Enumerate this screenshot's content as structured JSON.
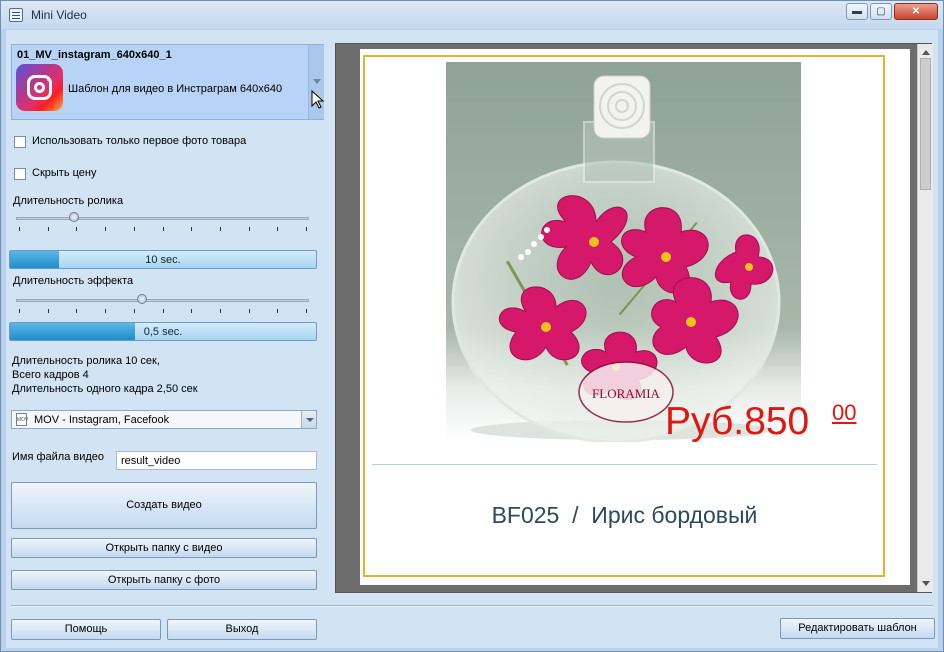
{
  "window": {
    "title": "Mini Video",
    "min_glyph": "▬",
    "max_glyph": "▢",
    "close_glyph": "✕"
  },
  "template": {
    "name": "01_MV_instagram_640x640_1",
    "description": "Шаблон для видео в Инстраграм 640x640",
    "icon": "instagram-icon"
  },
  "options": {
    "first_photo_only_label": "Использовать только первое фото товара",
    "first_photo_only_checked": false,
    "hide_price_label": "Скрыть цену",
    "hide_price_checked": false
  },
  "duration": {
    "label": "Длительность ролика",
    "slider_position": 0.19,
    "progress_text": "10 sec.",
    "progress_fraction": 0.16
  },
  "effect": {
    "label": "Длительность эффекта",
    "slider_position": 0.43,
    "progress_text": "0,5 sec.",
    "progress_fraction": 0.41
  },
  "summary": {
    "line1": "Длительность ролика 10 сек,",
    "line2": "Всего кадров 4",
    "line3": "Длительность одного кадра 2,50 сек"
  },
  "format": {
    "selected": "MOV - Instagram, Facefook",
    "icon_text": "MOV"
  },
  "filename": {
    "label": "Имя файла видео",
    "value": "result_video"
  },
  "buttons": {
    "create": "Создать видео",
    "open_video_folder": "Открыть папку с видео",
    "open_photo_folder": "Открыть папку с фото",
    "help": "Помощь",
    "exit": "Выход",
    "edit_template": "Редактировать шаблон"
  },
  "preview": {
    "price_main": "Руб.850",
    "price_cents": "00",
    "product_title": "BF025  /  Ирис бордовый",
    "brand_logo": "FLORAMIA",
    "accent_price": "#e3150f",
    "card_border": "#e8b12e"
  }
}
